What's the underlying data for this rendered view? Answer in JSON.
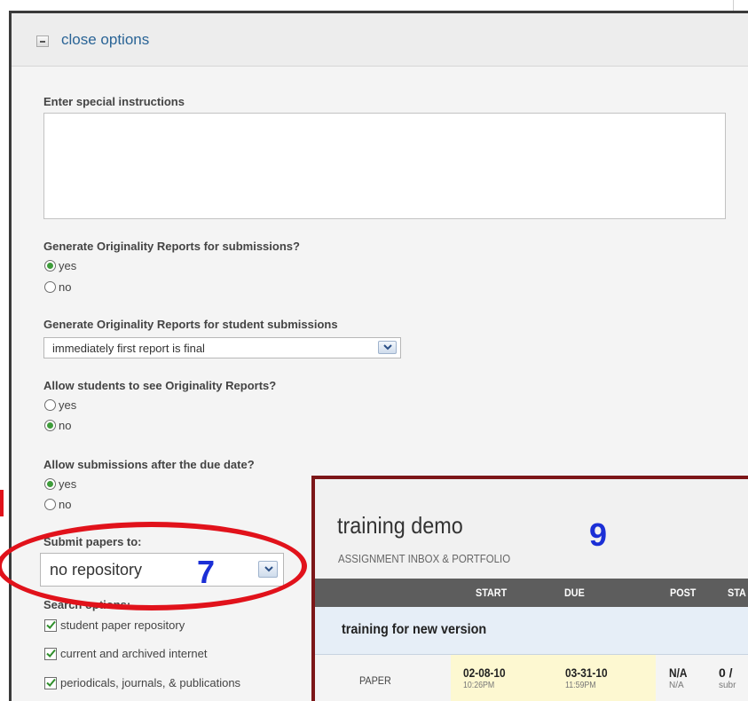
{
  "options_toggle": {
    "label": "close options"
  },
  "special_instructions": {
    "label": "Enter special instructions",
    "value": ""
  },
  "originality_reports": {
    "label": "Generate Originality Reports for submissions?",
    "options": [
      "yes",
      "no"
    ],
    "selected": "yes"
  },
  "student_reports": {
    "label": "Generate Originality Reports for student submissions",
    "selected_value": "immediately first report is final"
  },
  "see_reports": {
    "label": "Allow students to see Originality Reports?",
    "options": [
      "yes",
      "no"
    ],
    "selected": "no"
  },
  "late_submissions": {
    "label": "Allow submissions after the due date?",
    "options": [
      "yes",
      "no"
    ],
    "selected": "yes"
  },
  "repository": {
    "label": "Submit papers to:",
    "selected_value": "no repository"
  },
  "search_options": {
    "label": "Search options:",
    "items": [
      {
        "label": "student paper repository",
        "checked": true
      },
      {
        "label": "current and archived internet",
        "checked": true
      },
      {
        "label": "periodicals, journals, & publications",
        "checked": true
      }
    ]
  },
  "annotations": {
    "seven": "7",
    "nine": "9"
  },
  "inbox": {
    "title": "training demo",
    "subtitle": "ASSIGNMENT INBOX & PORTFOLIO",
    "columns": [
      "START",
      "DUE",
      "POST",
      "STA"
    ],
    "group": "training for new version",
    "row": {
      "type": "PAPER",
      "start_date": "02-08-10",
      "start_time": "10:26PM",
      "due_date": "03-31-10",
      "due_time": "11:59PM",
      "post": "N/A",
      "post_sub": "N/A",
      "status": "0 /",
      "status_sub": "subr"
    }
  },
  "colors": {
    "link": "#2a6496",
    "radio_selected": "#3e9c3a",
    "annotation_red": "#e1121b",
    "annotation_blue": "#1b2fd6",
    "inbox_border": "#7c1618"
  }
}
